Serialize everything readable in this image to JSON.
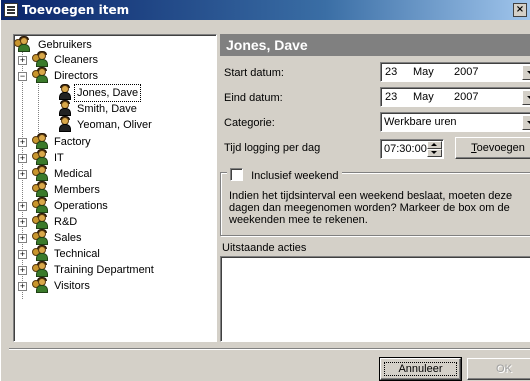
{
  "window": {
    "title": "Toevoegen item",
    "close_label": "×"
  },
  "tree": {
    "root_label": "Gebruikers",
    "groups": [
      {
        "label": "Cleaners",
        "expander": "+"
      },
      {
        "label": "Directors",
        "expander": "−"
      },
      {
        "label": "Factory",
        "expander": "+"
      },
      {
        "label": "IT",
        "expander": "+"
      },
      {
        "label": "Medical",
        "expander": "+"
      },
      {
        "label": "Members",
        "expander": ""
      },
      {
        "label": "Operations",
        "expander": "+"
      },
      {
        "label": "R&D",
        "expander": "+"
      },
      {
        "label": "Sales",
        "expander": "+"
      },
      {
        "label": "Technical",
        "expander": "+"
      },
      {
        "label": "Training Department",
        "expander": "+"
      },
      {
        "label": "Visitors",
        "expander": "+"
      }
    ],
    "users": [
      {
        "label": "Jones, Dave",
        "selected": true
      },
      {
        "label": "Smith, Dave",
        "selected": false
      },
      {
        "label": "Yeoman, Oliver",
        "selected": false
      }
    ]
  },
  "detail": {
    "header": "Jones, Dave",
    "start_label": "Start datum:",
    "start": {
      "day": "23",
      "month": "May",
      "year": "2007"
    },
    "end_label": "Eind datum:",
    "end": {
      "day": "23",
      "month": "May",
      "year": "2007"
    },
    "category_label": "Categorie:",
    "category_value": "Werkbare uren",
    "time_label": "Tijd logging per dag",
    "time_value": "07:30:00",
    "add_button_first": "T",
    "add_button_rest": "oevoegen",
    "weekend_label": "Inclusief weekend",
    "weekend_checked": false,
    "weekend_description": "Indien het tijdsinterval een weekend beslaat, moeten deze dagen dan meegenomen worden? Markeer de box om de weekenden mee te rekenen.",
    "pending_label": "Uitstaande acties",
    "pending_value": ""
  },
  "footer": {
    "cancel_label": "Annuleer",
    "ok_label": "OK"
  },
  "colors": {
    "title_start": "#0a246a",
    "title_end": "#a6caf0",
    "header_bg": "#808080",
    "face": "#d4d0c8"
  }
}
